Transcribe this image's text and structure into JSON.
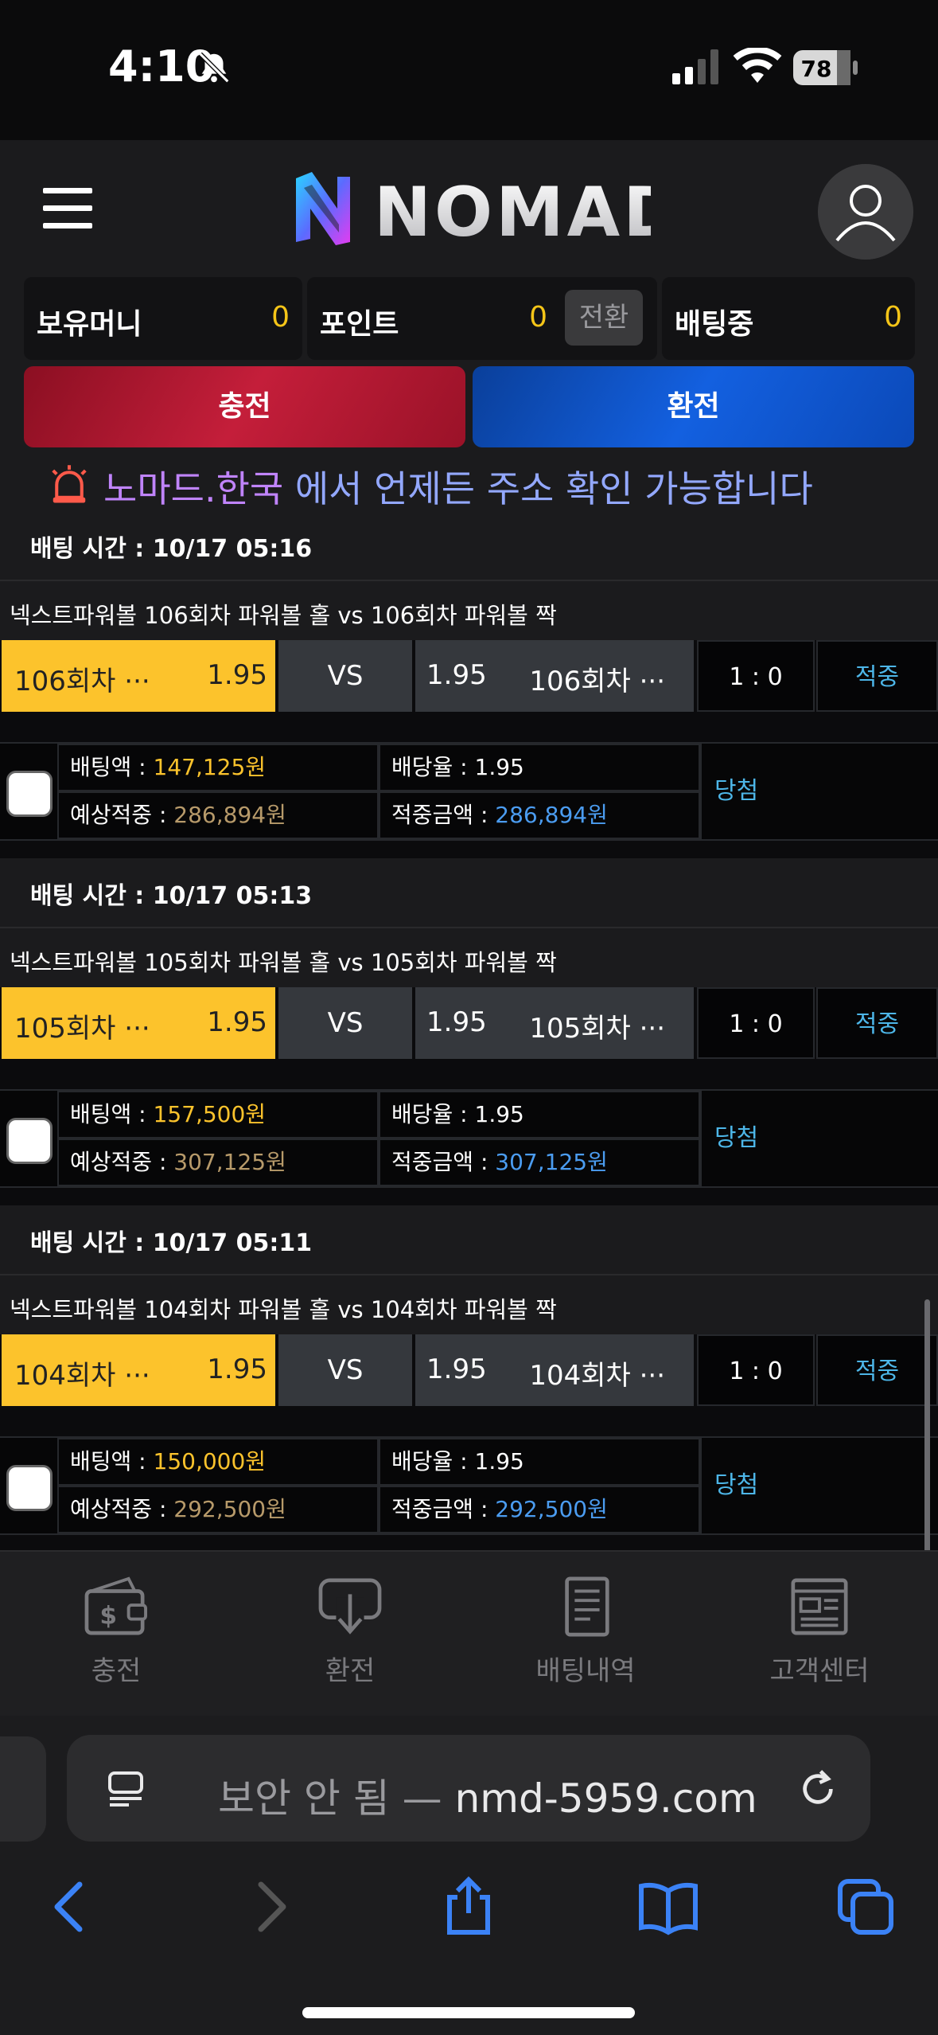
{
  "status": {
    "time": "4:10",
    "battery": "78"
  },
  "header": {
    "logo_text": "NOMAD"
  },
  "balances": {
    "money_label": "보유머니",
    "money_value": "0",
    "point_label": "포인트",
    "point_value": "0",
    "convert_label": "전환",
    "betting_label": "배팅중",
    "betting_value": "0"
  },
  "buttons": {
    "charge": "충전",
    "exchange": "환전"
  },
  "notice": {
    "domain": "노마드.한국",
    "rest": " 에서 언제든 주소 확인 가능합니다"
  },
  "bets": [
    {
      "time": "배팅 시간 : 10/17 05:16",
      "title": "넥스트파워볼 106회차 파워볼 홀  vs  106회차 파워볼 짝",
      "home_name": "106회차 ···",
      "home_odds": "1.95",
      "vs": "VS",
      "away_odds": "1.95",
      "away_name": "106회차 ···",
      "score": "1 : 0",
      "result": "적중",
      "bet_label": "배팅액 : ",
      "bet_amount": "147,125원",
      "rate_label": "배당율 : ",
      "rate": "1.95",
      "expected_label": "예상적중 : ",
      "expected": "286,894원",
      "win_label": "적중금액 : ",
      "win": "286,894원",
      "status": "당첨"
    },
    {
      "time": "배팅 시간 : 10/17 05:13",
      "title": "넥스트파워볼 105회차 파워볼 홀  vs  105회차 파워볼 짝",
      "home_name": "105회차 ···",
      "home_odds": "1.95",
      "vs": "VS",
      "away_odds": "1.95",
      "away_name": "105회차 ···",
      "score": "1 : 0",
      "result": "적중",
      "bet_label": "배팅액 : ",
      "bet_amount": "157,500원",
      "rate_label": "배당율 : ",
      "rate": "1.95",
      "expected_label": "예상적중 : ",
      "expected": "307,125원",
      "win_label": "적중금액 : ",
      "win": "307,125원",
      "status": "당첨"
    },
    {
      "time": "배팅 시간 : 10/17 05:11",
      "title": "넥스트파워볼 104회차 파워볼 홀  vs  104회차 파워볼 짝",
      "home_name": "104회차 ···",
      "home_odds": "1.95",
      "vs": "VS",
      "away_odds": "1.95",
      "away_name": "104회차 ···",
      "score": "1 : 0",
      "result": "적중",
      "bet_label": "배팅액 : ",
      "bet_amount": "150,000원",
      "rate_label": "배당율 : ",
      "rate": "1.95",
      "expected_label": "예상적중 : ",
      "expected": "292,500원",
      "win_label": "적중금액 : ",
      "win": "292,500원",
      "status": "당첨"
    }
  ],
  "bottom_nav": [
    {
      "label": "충전",
      "icon": "wallet-icon"
    },
    {
      "label": "환전",
      "icon": "withdraw-icon"
    },
    {
      "label": "배팅내역",
      "icon": "document-icon"
    },
    {
      "label": "고객센터",
      "icon": "newspaper-icon"
    }
  ],
  "browser": {
    "insecure": "보안 안 됨 — ",
    "domain": "nmd-5959.com"
  },
  "colors": {
    "accent_yellow": "#fcc32c",
    "charge_red": "#c41e3a",
    "exchange_blue": "#1360e0",
    "link_blue": "#4db6e8"
  }
}
